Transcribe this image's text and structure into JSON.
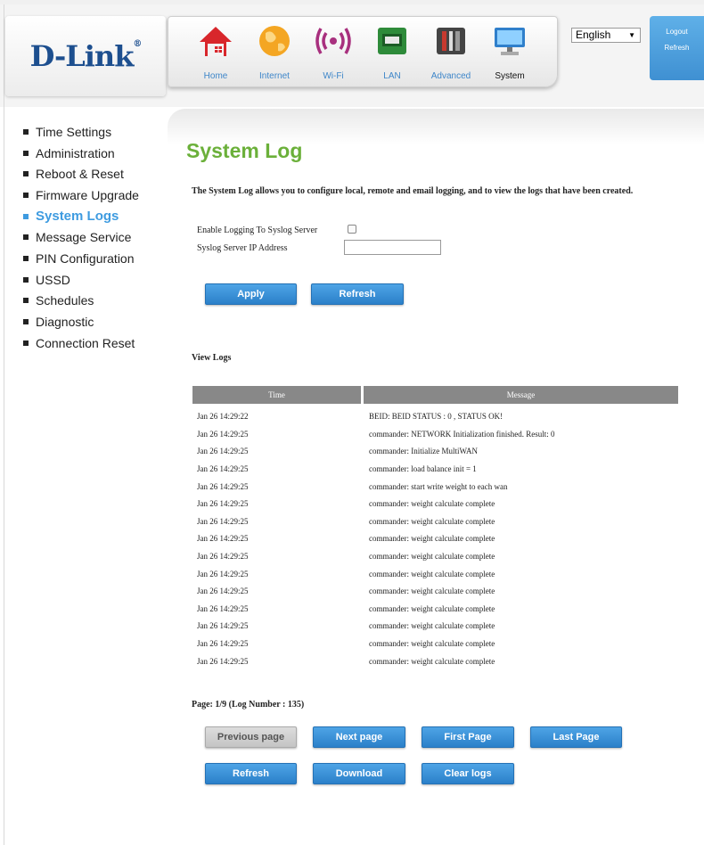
{
  "brand": {
    "logo_text": "D-Link",
    "logo_mark": "®"
  },
  "nav": [
    {
      "label": "Home",
      "icon": "home-icon"
    },
    {
      "label": "Internet",
      "icon": "globe-icon"
    },
    {
      "label": "Wi-Fi",
      "icon": "wifi-icon"
    },
    {
      "label": "LAN",
      "icon": "lan-icon"
    },
    {
      "label": "Advanced",
      "icon": "tools-icon"
    },
    {
      "label": "System",
      "icon": "computer-icon"
    }
  ],
  "language": {
    "selected": "English"
  },
  "header_buttons": {
    "logout": "Logout",
    "refresh": "Refresh"
  },
  "sidebar": [
    "Time Settings",
    "Administration",
    "Reboot & Reset",
    "Firmware Upgrade",
    "System Logs",
    "Message Service",
    "PIN Configuration",
    "USSD",
    "Schedules",
    "Diagnostic",
    "Connection Reset"
  ],
  "page": {
    "title": "System Log",
    "description": "The System Log allows you to configure local, remote and email logging, and to view the logs that have been created."
  },
  "form": {
    "enable_label": "Enable Logging To Syslog Server",
    "ip_label": "Syslog Server IP Address",
    "ip_value": "",
    "apply": "Apply",
    "refresh": "Refresh"
  },
  "logs": {
    "section_title": "View Logs",
    "col_time": "Time",
    "col_message": "Message",
    "rows": [
      {
        "time": "Jan 26 14:29:22",
        "message": "BEID: BEID STATUS : 0 , STATUS OK!"
      },
      {
        "time": "Jan 26 14:29:25",
        "message": "commander: NETWORK Initialization finished. Result: 0"
      },
      {
        "time": "Jan 26 14:29:25",
        "message": "commander: Initialize MultiWAN"
      },
      {
        "time": "Jan 26 14:29:25",
        "message": "commander: load balance init = 1"
      },
      {
        "time": "Jan 26 14:29:25",
        "message": "commander: start write weight to each wan"
      },
      {
        "time": "Jan 26 14:29:25",
        "message": "commander: weight calculate complete"
      },
      {
        "time": "Jan 26 14:29:25",
        "message": "commander: weight calculate complete"
      },
      {
        "time": "Jan 26 14:29:25",
        "message": "commander: weight calculate complete"
      },
      {
        "time": "Jan 26 14:29:25",
        "message": "commander: weight calculate complete"
      },
      {
        "time": "Jan 26 14:29:25",
        "message": "commander: weight calculate complete"
      },
      {
        "time": "Jan 26 14:29:25",
        "message": "commander: weight calculate complete"
      },
      {
        "time": "Jan 26 14:29:25",
        "message": "commander: weight calculate complete"
      },
      {
        "time": "Jan 26 14:29:25",
        "message": "commander: weight calculate complete"
      },
      {
        "time": "Jan 26 14:29:25",
        "message": "commander: weight calculate complete"
      },
      {
        "time": "Jan 26 14:29:25",
        "message": "commander: weight calculate complete"
      }
    ],
    "page_info": "Page: 1/9 (Log Number : 135)"
  },
  "pager": {
    "previous": "Previous page",
    "next": "Next page",
    "first": "First Page",
    "last": "Last Page",
    "refresh": "Refresh",
    "download": "Download",
    "clear": "Clear logs"
  },
  "colors": {
    "accent_blue": "#3e9be0",
    "title_green": "#6bb03a",
    "header_gray": "#888888"
  }
}
